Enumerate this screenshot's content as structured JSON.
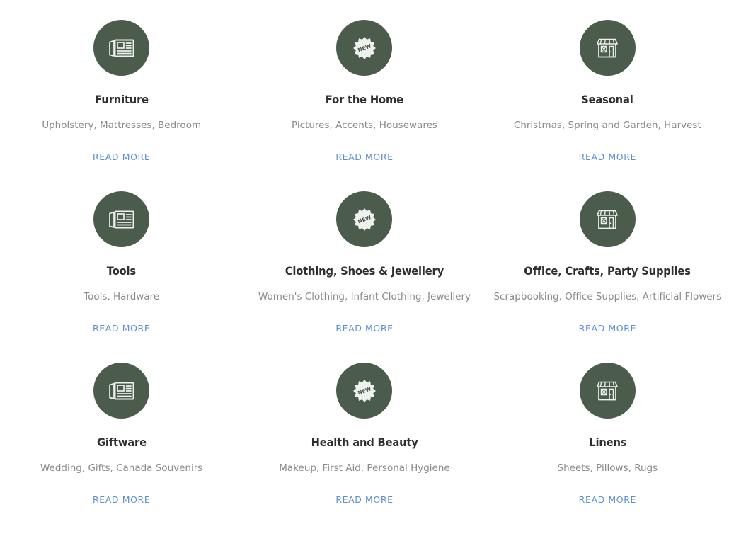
{
  "theme": {
    "icon_circle_color": "#4c5c4c",
    "icon_glyph_color": "#eef1ee",
    "title_color": "#2f2f2f",
    "description_color": "#8a8a8a",
    "link_color": "#5b8ed4",
    "background_color": "#ffffff"
  },
  "grid": {
    "columns": 3,
    "rows": 3,
    "cards": [
      {
        "icon": "newspaper-icon",
        "title": "Furniture",
        "description": "Upholstery, Mattresses, Bedroom",
        "link_label": "READ MORE"
      },
      {
        "icon": "new-badge-icon",
        "title": "For the Home",
        "description": "Pictures, Accents, Housewares",
        "link_label": "READ MORE"
      },
      {
        "icon": "storefront-icon",
        "title": "Seasonal",
        "description": "Christmas, Spring and Garden, Harvest",
        "link_label": "READ MORE"
      },
      {
        "icon": "newspaper-icon",
        "title": "Tools",
        "description": "Tools, Hardware",
        "link_label": "READ MORE"
      },
      {
        "icon": "new-badge-icon",
        "title": "Clothing, Shoes & Jewellery",
        "description": "Women's Clothing, Infant Clothing, Jewellery",
        "link_label": "READ MORE"
      },
      {
        "icon": "storefront-icon",
        "title": "Office, Crafts, Party Supplies",
        "description": "Scrapbooking, Office Supplies, Artificial Flowers",
        "link_label": "READ MORE"
      },
      {
        "icon": "newspaper-icon",
        "title": "Giftware",
        "description": "Wedding, Gifts, Canada Souvenirs",
        "link_label": "READ MORE"
      },
      {
        "icon": "new-badge-icon",
        "title": "Health and Beauty",
        "description": "Makeup, First Aid, Personal Hygiene",
        "link_label": "READ MORE"
      },
      {
        "icon": "storefront-icon",
        "title": "Linens",
        "description": "Sheets, Pillows, Rugs",
        "link_label": "READ MORE"
      }
    ]
  },
  "icon_badge_text": "NEW"
}
